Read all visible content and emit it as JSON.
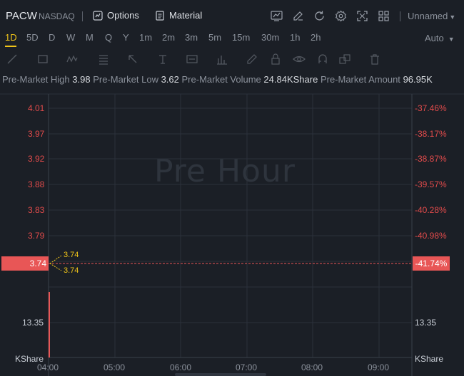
{
  "header": {
    "symbol": "PACW",
    "exchange": "NASDAQ",
    "options_label": "Options",
    "material_label": "Material",
    "layout_name": "Unnamed"
  },
  "periods": [
    "1D",
    "5D",
    "D",
    "W",
    "M",
    "Q",
    "Y",
    "1m",
    "2m",
    "3m",
    "5m",
    "15m",
    "30m",
    "1h",
    "2h"
  ],
  "active_period": "1D",
  "scale_mode": "Auto",
  "info": {
    "high_label": "Pre-Market High",
    "high_value": "3.98",
    "low_label": "Pre-Market Low",
    "low_value": "3.62",
    "volume_label": "Pre-Market Volume",
    "volume_value": "24.84KShare",
    "amount_label": "Pre-Market Amount",
    "amount_value": "96.95K"
  },
  "chart": {
    "watermark": "Pre Hour",
    "y_left": [
      "4.01",
      "3.97",
      "3.92",
      "3.88",
      "3.83",
      "3.79"
    ],
    "y_right": [
      "-37.46%",
      "-38.17%",
      "-38.87%",
      "-39.57%",
      "-40.28%",
      "-40.98%"
    ],
    "current_price": "3.74",
    "current_change": "-41.74%",
    "tick_high": "3.74",
    "tick_low": "3.74",
    "volume_max": "13.35",
    "volume_unit": "KShare",
    "x_labels": [
      "04:00",
      "05:00",
      "06:00",
      "07:00",
      "08:00",
      "09:00"
    ]
  },
  "colors": {
    "background": "#1b1f26",
    "grid": "#2b313b",
    "down": "#e85656",
    "accent": "#f0c419"
  }
}
